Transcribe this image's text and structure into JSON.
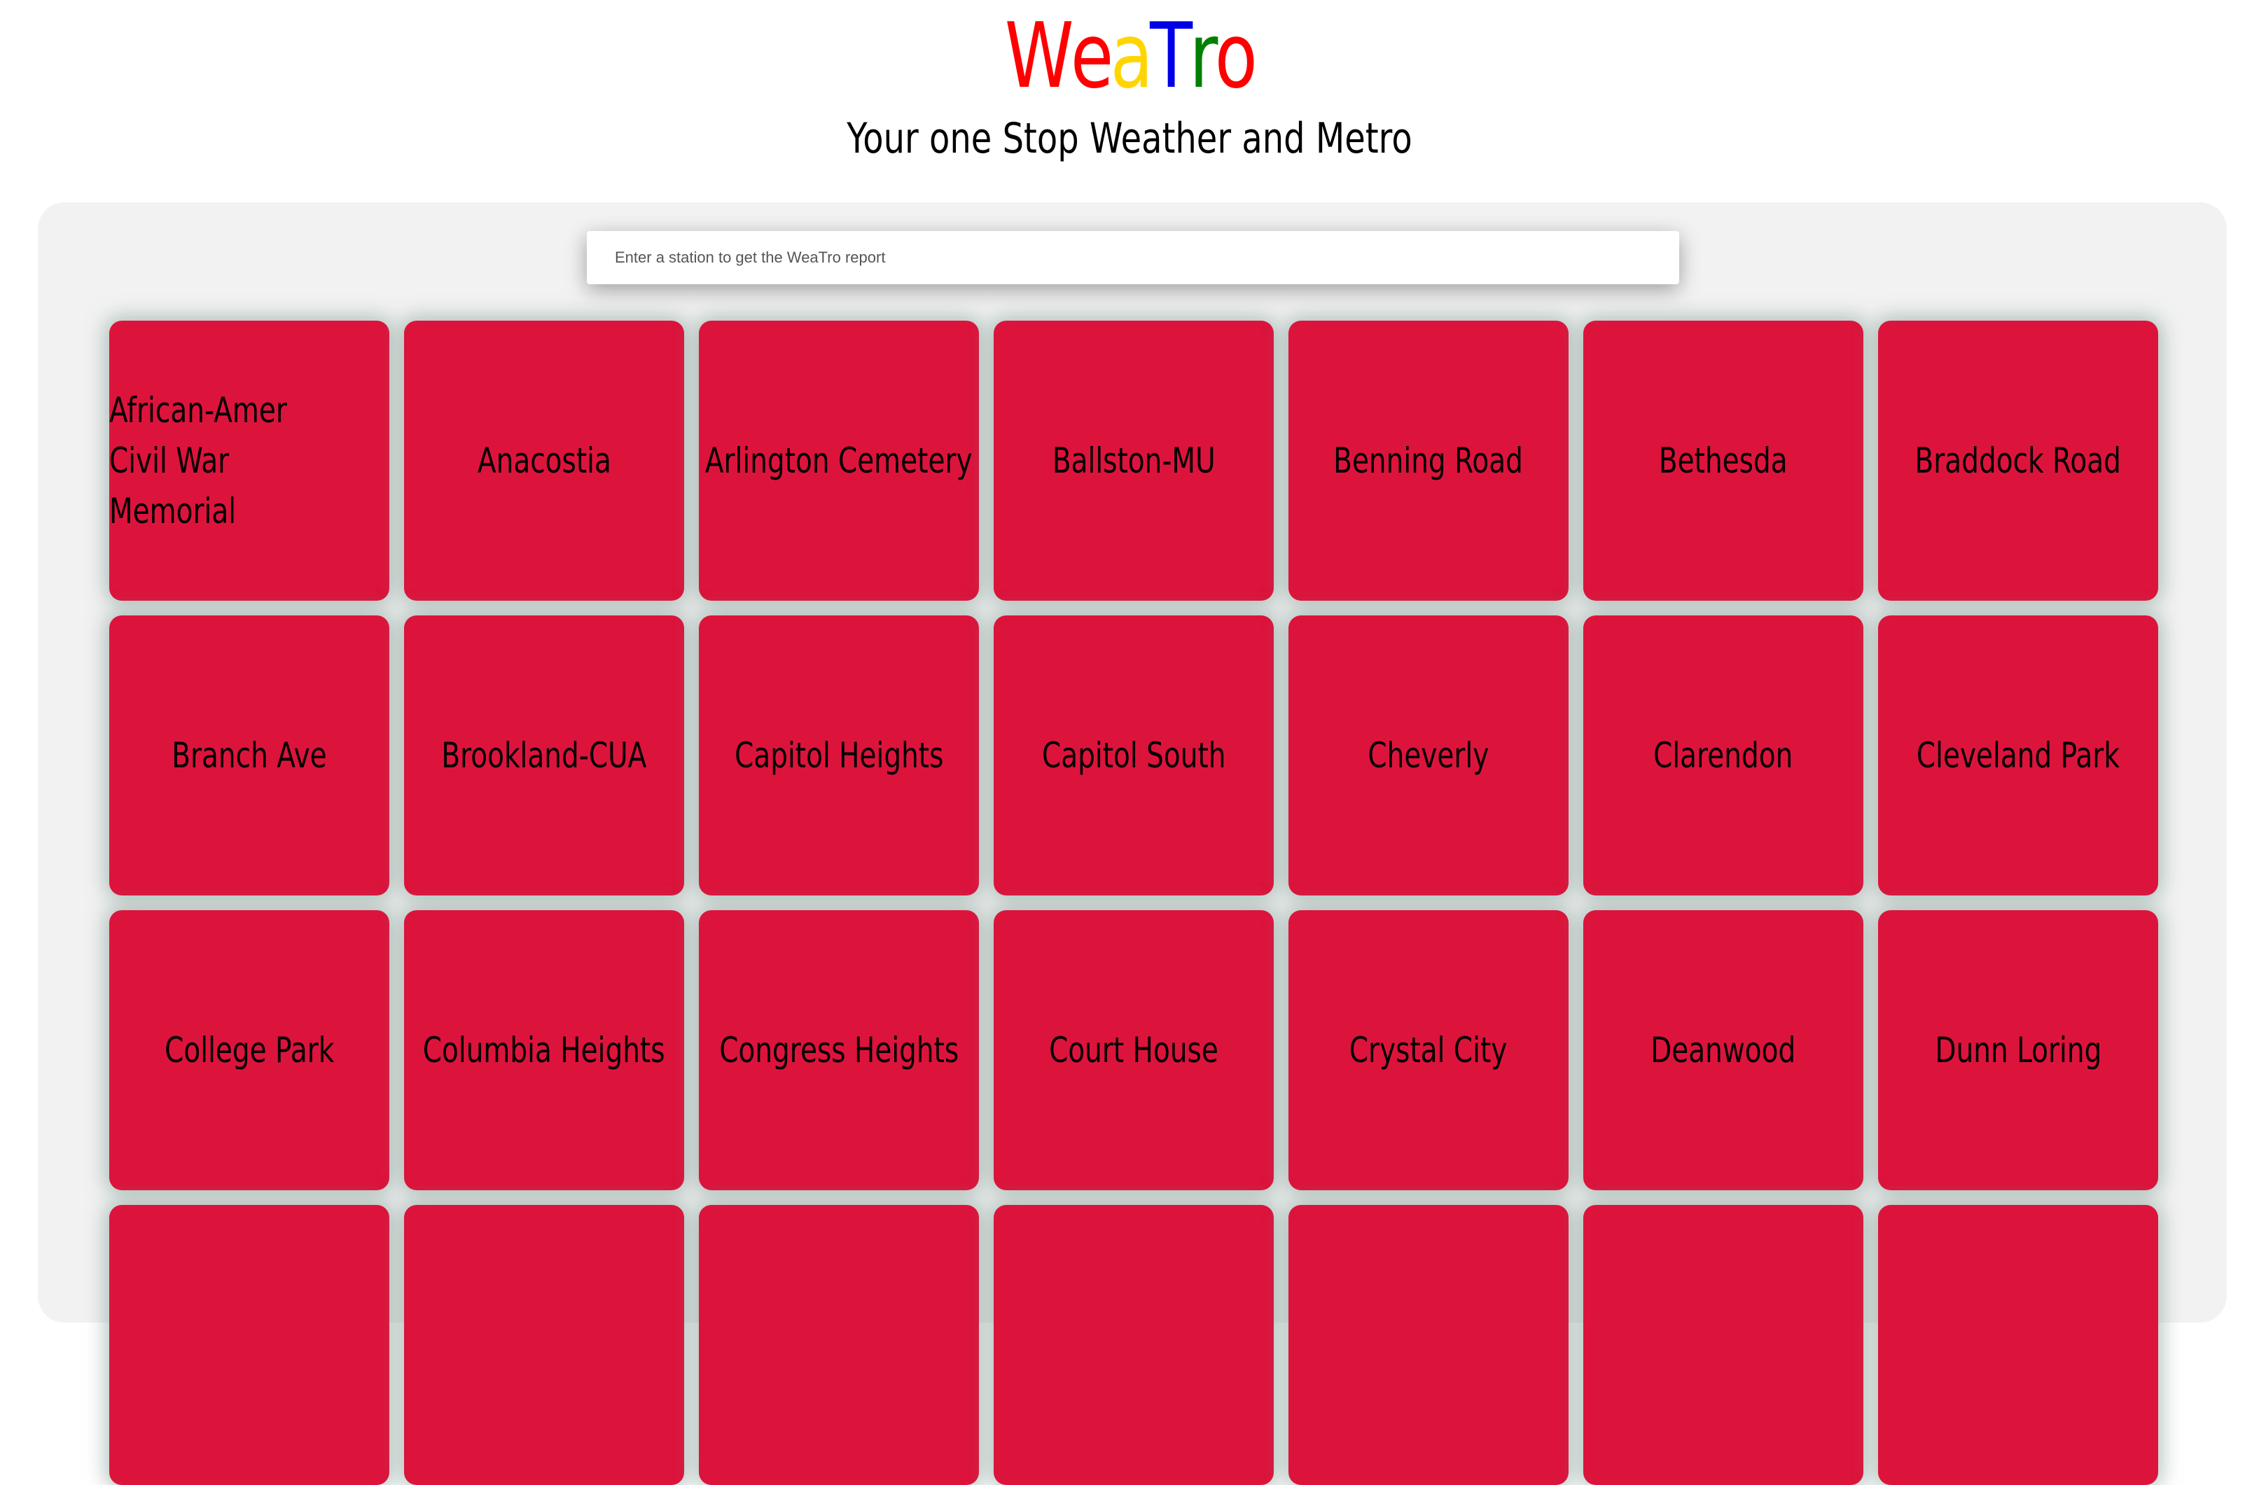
{
  "header": {
    "logo_letters": [
      {
        "char": "W",
        "color": "#ff0000"
      },
      {
        "char": "e",
        "color": "#ff0000"
      },
      {
        "char": "a",
        "color": "#ffd500"
      },
      {
        "char": "T",
        "color": "#0000e6"
      },
      {
        "char": "r",
        "color": "#008000"
      },
      {
        "char": "o",
        "color": "#ff0000"
      }
    ],
    "tagline": "Your one Stop Weather and Metro"
  },
  "search": {
    "placeholder": "Enter a station to get the WeaTro report",
    "value": ""
  },
  "colors": {
    "card_background": "#dc143c",
    "panel_background": "#f2f2f2"
  },
  "stations": [
    "African-Amer Civil War Memorial",
    "Anacostia",
    "Arlington Cemetery",
    "Ballston-MU",
    "Benning Road",
    "Bethesda",
    "Braddock Road",
    "Branch Ave",
    "Brookland-CUA",
    "Capitol Heights",
    "Capitol South",
    "Cheverly",
    "Clarendon",
    "Cleveland Park",
    "College Park",
    "Columbia Heights",
    "Congress Heights",
    "Court House",
    "Crystal City",
    "Deanwood",
    "Dunn Loring",
    "",
    "",
    "",
    "",
    "",
    "",
    ""
  ]
}
